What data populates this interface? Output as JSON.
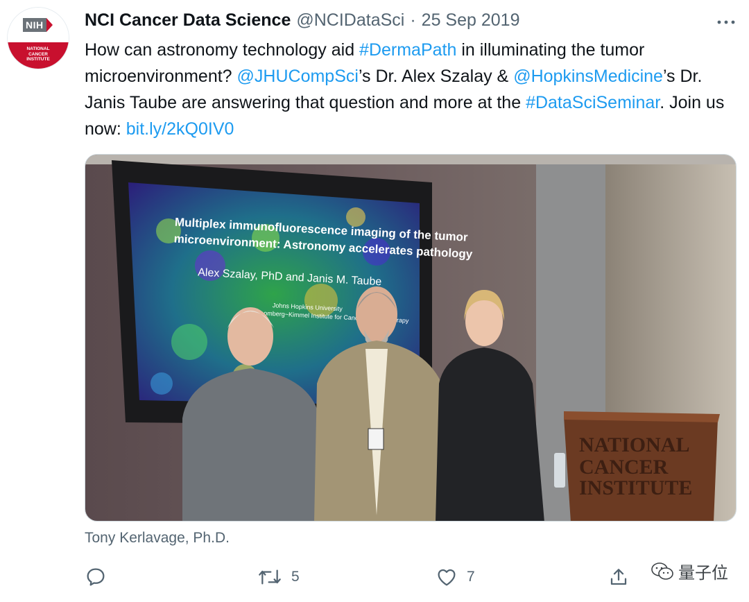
{
  "tweet": {
    "author_name": "NCI Cancer Data Science",
    "handle": "@NCIDataSci",
    "separator": "·",
    "date": "25 Sep 2019",
    "more_icon": "more-dots-icon",
    "text_parts": [
      {
        "t": "How can astronomy technology aid ",
        "link": false
      },
      {
        "t": "#DermaPath",
        "link": true
      },
      {
        "t": " in illuminating the tumor microenvironment? ",
        "link": false
      },
      {
        "t": "@JHUCompSci",
        "link": true
      },
      {
        "t": "’s Dr. Alex Szalay & ",
        "link": false
      },
      {
        "t": "@HopkinsMedicine",
        "link": true
      },
      {
        "t": "’s Dr. Janis Taube are answering that question and more at the ",
        "link": false
      },
      {
        "t": "#DataSciSeminar",
        "link": true
      },
      {
        "t": ". Join us now: ",
        "link": false
      },
      {
        "t": "bit.ly/2kQ0IV0",
        "link": true
      }
    ],
    "photo_caption": "Tony Kerlavage, Ph.D."
  },
  "avatar": {
    "badge": "NIH",
    "lines": [
      "NATIONAL",
      "CANCER",
      "INSTITUTE"
    ]
  },
  "photo": {
    "slide_title_1": "Multiplex immunofluorescence imaging of the tumor",
    "slide_title_2": "microenvironment: Astronomy accelerates pathology",
    "slide_authors": "Alex Szalay, PhD and Janis M. Taube",
    "slide_affil_1": "Johns Hopkins University",
    "slide_affil_2": "Bloomberg~Kimmel Institute for Cancer Immunotherapy",
    "podium_1": "NATIONAL",
    "podium_2": "CANCER",
    "podium_3": "INSTITUTE"
  },
  "actions": {
    "reply_icon": "reply-icon",
    "retweet_icon": "retweet-icon",
    "retweet_count": "5",
    "like_icon": "heart-icon",
    "like_count": "7",
    "share_icon": "share-icon"
  },
  "watermark": {
    "text": "量子位"
  },
  "colors": {
    "link": "#1d9bf0",
    "muted": "#536471",
    "nih_red": "#c8102e"
  }
}
